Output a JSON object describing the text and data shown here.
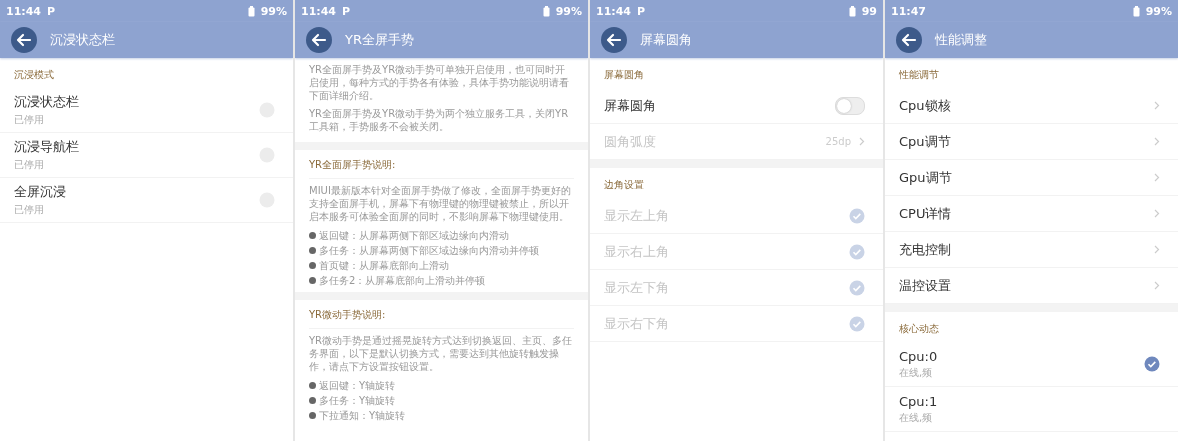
{
  "panels": [
    {
      "status": {
        "time": "11:44",
        "notification": "P",
        "battery": "99%"
      },
      "title": "沉浸状态栏",
      "sections": [
        {
          "kind": "list",
          "label": "沉浸模式",
          "items": [
            {
              "kind": "check",
              "title": "沉浸状态栏",
              "subtitle": "已停用",
              "checked": false,
              "disabled": false
            },
            {
              "kind": "check",
              "title": "沉浸导航栏",
              "subtitle": "已停用",
              "checked": false,
              "disabled": false
            },
            {
              "kind": "check",
              "title": "全屏沉浸",
              "subtitle": "已停用",
              "checked": false,
              "disabled": false
            }
          ]
        }
      ]
    },
    {
      "status": {
        "time": "11:44",
        "notification": "P",
        "battery": "99%"
      },
      "title": "YR全屏手势",
      "sections": [
        {
          "kind": "article",
          "blocks": [
            {
              "kind": "p",
              "text": "YR全面屏手势及YR微动手势可单独开启使用，也可同时开启使用，每种方式的手势各有体验，具体手势功能说明请看下面详细介绍。"
            },
            {
              "kind": "p",
              "text": "YR全面屏手势及YR微动手势为两个独立服务工具，关闭YR工具箱，手势服务不会被关闭。"
            }
          ]
        },
        {
          "kind": "article",
          "heading": "YR全面屏手势说明:",
          "blocks": [
            {
              "kind": "p",
              "text": "MIUI最新版本针对全面屏手势做了修改，全面屏手势更好的支持全面屏手机，屏幕下有物理键的物理键被禁止，所以开启本服务可体验全面屏的同时，不影响屏幕下物理键使用。"
            },
            {
              "kind": "bullet",
              "text": "返回键：从屏幕两侧下部区域边缘向内滑动"
            },
            {
              "kind": "bullet",
              "text": "多任务：从屏幕两侧下部区域边缘向内滑动并停顿"
            },
            {
              "kind": "bullet",
              "text": "首页键：从屏幕底部向上滑动"
            },
            {
              "kind": "bullet",
              "text": "多任务2：从屏幕底部向上滑动并停顿"
            }
          ]
        },
        {
          "kind": "article",
          "heading": "YR微动手势说明:",
          "blocks": [
            {
              "kind": "p",
              "text": "YR微动手势是通过摇晃旋转方式达到切换返回、主页、多任务界面，以下是默认切换方式，需要达到其他旋转触发操作，请点下方设置按钮设置。"
            },
            {
              "kind": "bullet",
              "text": "返回键：Y轴旋转"
            },
            {
              "kind": "bullet",
              "text": "多任务：Y轴旋转"
            },
            {
              "kind": "bullet",
              "text": "下拉通知：Y轴旋转"
            }
          ]
        }
      ]
    },
    {
      "status": {
        "time": "11:44",
        "notification": "P",
        "battery": "99"
      },
      "title": "屏幕圆角",
      "sections": [
        {
          "kind": "list",
          "label": "屏幕圆角",
          "items": [
            {
              "kind": "switch",
              "title": "屏幕圆角",
              "on": false,
              "disabled": false
            },
            {
              "kind": "value",
              "title": "圆角弧度",
              "value": "25dp",
              "disabled": true
            }
          ]
        },
        {
          "kind": "list",
          "label": "边角设置",
          "items": [
            {
              "kind": "check",
              "title": "显示左上角",
              "checked": true,
              "disabled": true
            },
            {
              "kind": "check",
              "title": "显示右上角",
              "checked": true,
              "disabled": true
            },
            {
              "kind": "check",
              "title": "显示左下角",
              "checked": true,
              "disabled": true
            },
            {
              "kind": "check",
              "title": "显示右下角",
              "checked": true,
              "disabled": true
            }
          ]
        }
      ]
    },
    {
      "status": {
        "time": "11:47",
        "battery": "99%"
      },
      "title": "性能调整",
      "sections": [
        {
          "kind": "list",
          "label": "性能调节",
          "items": [
            {
              "kind": "nav",
              "title": "Cpu锁核",
              "disabled": false
            },
            {
              "kind": "nav",
              "title": "Cpu调节",
              "disabled": false
            },
            {
              "kind": "nav",
              "title": "Gpu调节",
              "disabled": false
            },
            {
              "kind": "nav",
              "title": "CPU详情",
              "disabled": false
            },
            {
              "kind": "nav",
              "title": "充电控制",
              "disabled": false
            },
            {
              "kind": "nav",
              "title": "温控设置",
              "disabled": false
            }
          ]
        },
        {
          "kind": "list",
          "label": "核心动态",
          "items": [
            {
              "kind": "check",
              "title": "Cpu:0",
              "subtitle": "在线,频",
              "checked": true,
              "disabled": false
            },
            {
              "kind": "plain",
              "title": "Cpu:1",
              "subtitle": "在线,频",
              "disabled": false
            }
          ]
        }
      ]
    }
  ]
}
